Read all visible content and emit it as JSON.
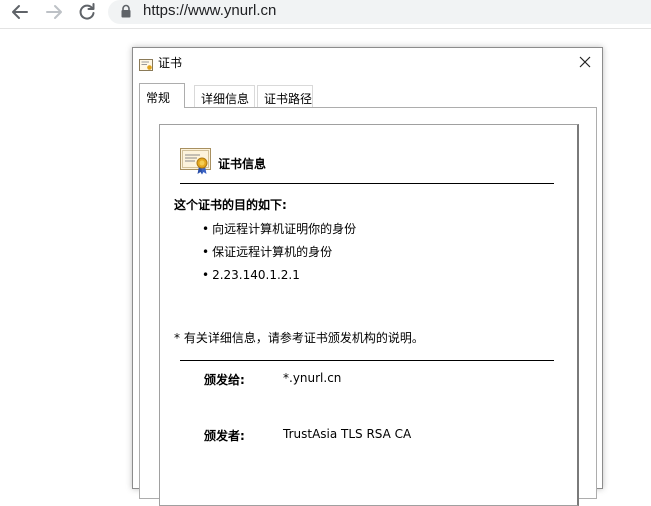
{
  "browser": {
    "url": "https://www.ynurl.cn"
  },
  "dialog": {
    "title": "证书",
    "tabs": [
      {
        "label": "常规"
      },
      {
        "label": "详细信息"
      },
      {
        "label": "证书路径"
      }
    ],
    "cert_info_heading": "证书信息",
    "purpose_heading": "这个证书的目的如下:",
    "purposes": [
      "向远程计算机证明你的身份",
      "保证远程计算机的身份",
      "2.23.140.1.2.1"
    ],
    "note": "* 有关详细信息，请参考证书颁发机构的说明。",
    "issued_to_label": "颁发给:",
    "issued_to_value": "*.ynurl.cn",
    "issued_by_label": "颁发者:",
    "issued_by_value": "TrustAsia TLS RSA CA"
  }
}
